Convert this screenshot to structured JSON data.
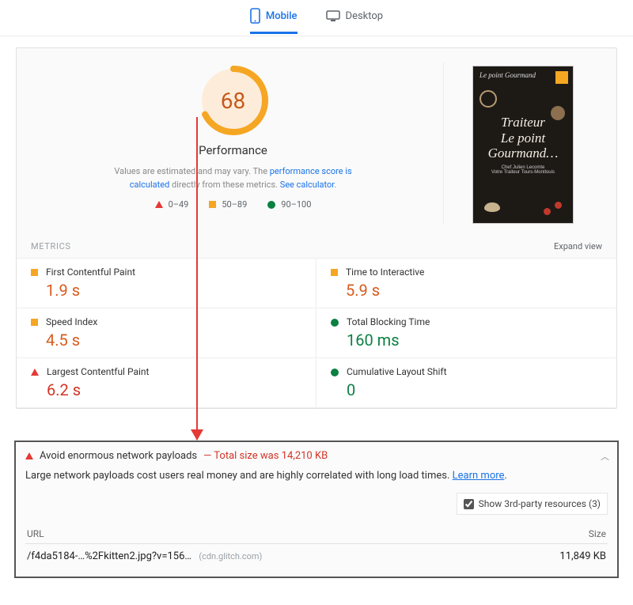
{
  "tabs": {
    "mobile": "Mobile",
    "desktop": "Desktop"
  },
  "score": {
    "value": "68",
    "label": "Performance",
    "note_before": "Values are estimated and may vary. The ",
    "note_link1": "performance score is calculated",
    "note_middle": " directly from these metrics. ",
    "note_link2": "See calculator",
    "note_after": "."
  },
  "legend": {
    "low": "0–49",
    "mid": "50–89",
    "high": "90–100"
  },
  "preview": {
    "brand": "Le point Gourmand",
    "line1": "Traiteur",
    "line2": "Le point",
    "line3": "Gourmand…",
    "sub1": "Chef Julien Lecomte",
    "sub2": "Votre Traiteur Tours-Montlouis"
  },
  "metrics_header": "METRICS",
  "expand_label": "Expand view",
  "metrics": {
    "fcp": {
      "label": "First Contentful Paint",
      "value": "1.9 s"
    },
    "tti": {
      "label": "Time to Interactive",
      "value": "5.9 s"
    },
    "si": {
      "label": "Speed Index",
      "value": "4.5 s"
    },
    "tbt": {
      "label": "Total Blocking Time",
      "value": "160 ms"
    },
    "lcp": {
      "label": "Largest Contentful Paint",
      "value": "6.2 s"
    },
    "cls": {
      "label": "Cumulative Layout Shift",
      "value": "0"
    }
  },
  "audit": {
    "title": "Avoid enormous network payloads",
    "sep": "  —  ",
    "total": "Total size was 14,210 KB",
    "desc_before": "Large network payloads cost users real money and are highly correlated with long load times. ",
    "learn_more": "Learn more",
    "desc_after": ".",
    "thirdparty_label": "Show 3rd-party resources (3)",
    "col_url": "URL",
    "col_size": "Size",
    "row_url": "/f4da5184-…%2Fkitten2.jpg?v=156…",
    "row_host": "(cdn.glitch.com)",
    "row_size": "11,849 KB"
  }
}
